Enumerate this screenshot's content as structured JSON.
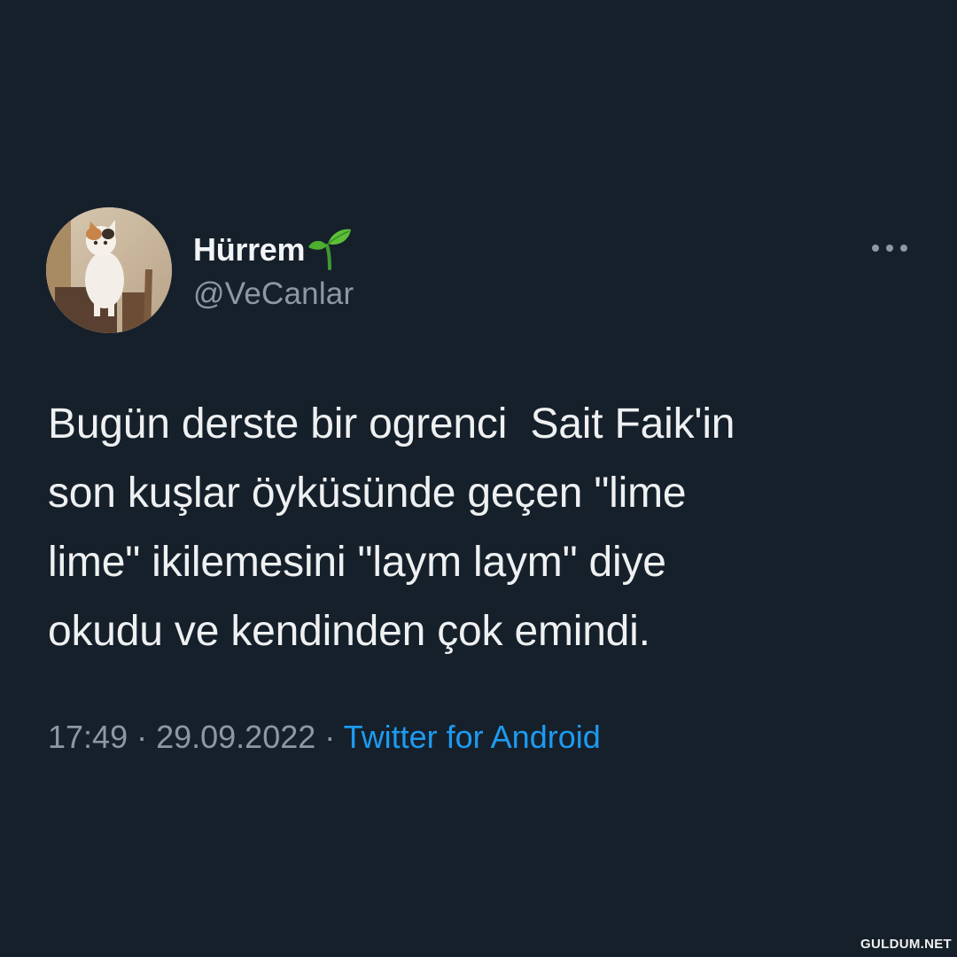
{
  "tweet": {
    "display_name": "Hürrem",
    "name_emoji_icon": "seedling-icon",
    "handle": "@VeCanlar",
    "text": "Bugün derste bir ogrenci  Sait Faik'in son kuşlar öyküsünde geçen \"lime lime\" ikilemesini \"laym laym\" diye okudu ve kendinden çok emindi.",
    "text_lines": [
      "Bugün derste bir ogrenci  Sait Faik'in",
      "son kuşlar öyküsünde geçen \"lime",
      "lime\" ikilemesini \"laym laym\" diye",
      "okudu ve kendinden çok emindi."
    ],
    "time": "17:49",
    "separator": " · ",
    "date": "29.09.2022",
    "source": "Twitter for Android",
    "more_icon": "more-horizontal-icon",
    "avatar_icon": "cat-avatar-icon"
  },
  "watermark": "GULDUM.NET",
  "colors": {
    "background": "#16202b",
    "text_primary": "#eef0f1",
    "text_secondary": "#8b98a5",
    "link": "#1d9bf0"
  }
}
